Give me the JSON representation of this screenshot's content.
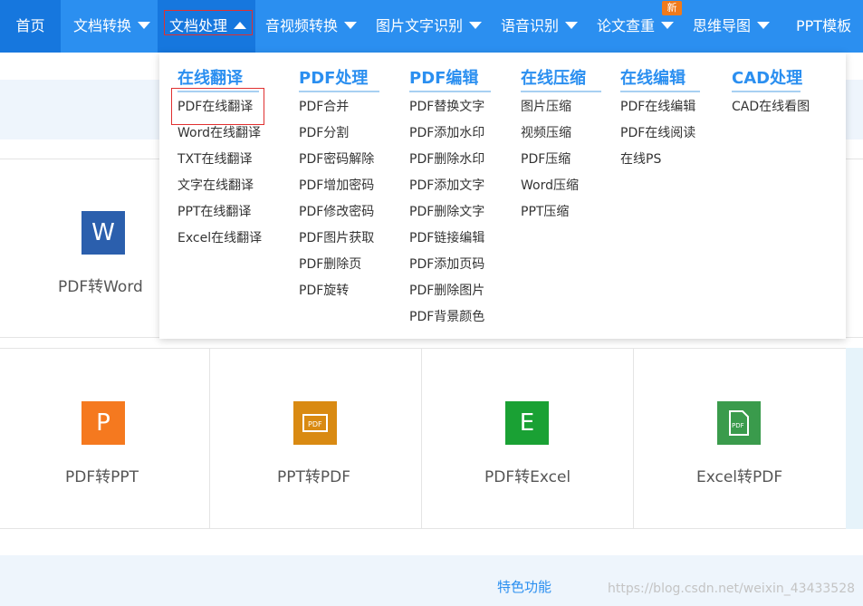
{
  "nav": {
    "home": "首页",
    "items": [
      "文档转换",
      "文档处理",
      "音视频转换",
      "图片文字识别",
      "语音识别",
      "论文查重",
      "思维导图"
    ],
    "last": "PPT模板",
    "badge": "新"
  },
  "dropdown": {
    "columns": [
      {
        "title": "在线翻译",
        "items": [
          "PDF在线翻译",
          "Word在线翻译",
          "TXT在线翻译",
          "文字在线翻译",
          "PPT在线翻译",
          "Excel在线翻译"
        ]
      },
      {
        "title": "PDF处理",
        "items": [
          "PDF合并",
          "PDF分割",
          "PDF密码解除",
          "PDF增加密码",
          "PDF修改密码",
          "PDF图片获取",
          "PDF删除页",
          "PDF旋转"
        ]
      },
      {
        "title": "PDF编辑",
        "items": [
          "PDF替换文字",
          "PDF添加水印",
          "PDF删除水印",
          "PDF添加文字",
          "PDF删除文字",
          "PDF链接编辑",
          "PDF添加页码",
          "PDF删除图片",
          "PDF背景颜色"
        ]
      },
      {
        "title": "在线压缩",
        "items": [
          "图片压缩",
          "视频压缩",
          "PDF压缩",
          "Word压缩",
          "PPT压缩"
        ]
      },
      {
        "title": "在线编辑",
        "items": [
          "PDF在线编辑",
          "PDF在线阅读",
          "在线PS"
        ]
      },
      {
        "title": "CAD处理",
        "items": [
          "CAD在线看图"
        ]
      }
    ]
  },
  "tools": {
    "word": {
      "label": "PDF转Word",
      "glyph": "W",
      "color": "#2b5fad"
    },
    "row2": [
      {
        "label": "PDF转PPT",
        "glyph": "P",
        "color": "#f5791f"
      },
      {
        "label": "PPT转PDF",
        "glyph": "PDF",
        "color": "#d98a12"
      },
      {
        "label": "PDF转Excel",
        "glyph": "E",
        "color": "#1aa134"
      },
      {
        "label": "Excel转PDF",
        "glyph": "PDF",
        "color": "#3a9b4c"
      }
    ]
  },
  "section": {
    "label": "特色功能"
  },
  "watermark": "https://blog.csdn.net/weixin_43433528"
}
